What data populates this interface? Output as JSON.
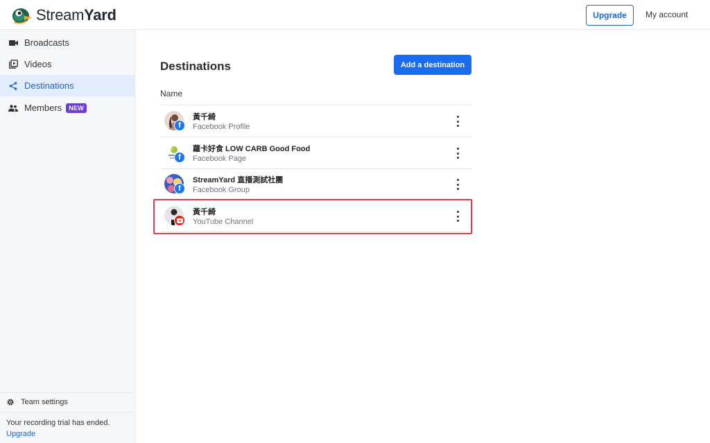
{
  "brand": {
    "name_light": "Stream",
    "name_bold": "Yard"
  },
  "header": {
    "upgrade_label": "Upgrade",
    "account_label": "My account"
  },
  "sidebar": {
    "items": [
      {
        "label": "Broadcasts",
        "icon": "video-camera-icon"
      },
      {
        "label": "Videos",
        "icon": "video-library-icon"
      },
      {
        "label": "Destinations",
        "icon": "share-icon",
        "active": true
      },
      {
        "label": "Members",
        "icon": "people-icon",
        "badge": "NEW"
      }
    ],
    "team_settings": "Team settings",
    "trial_text": "Your recording trial has ended.",
    "trial_upgrade": "Upgrade"
  },
  "main": {
    "title": "Destinations",
    "add_button": "Add a destination",
    "column_header": "Name",
    "destinations": [
      {
        "name": "黃千綺",
        "type": "Facebook Profile",
        "platform": "facebook"
      },
      {
        "name": "蘿卡好食 LOW CARB Good Food",
        "type": "Facebook Page",
        "platform": "facebook"
      },
      {
        "name": "StreamYard 直播測試社團",
        "type": "Facebook Group",
        "platform": "facebook"
      },
      {
        "name": "黃千綺",
        "type": "YouTube Channel",
        "platform": "youtube"
      }
    ]
  },
  "colors": {
    "accent": "#1a6cf0",
    "active_bg": "#e3ecfa",
    "badge": "#6f3bd6",
    "highlight": "#e23b4a"
  }
}
